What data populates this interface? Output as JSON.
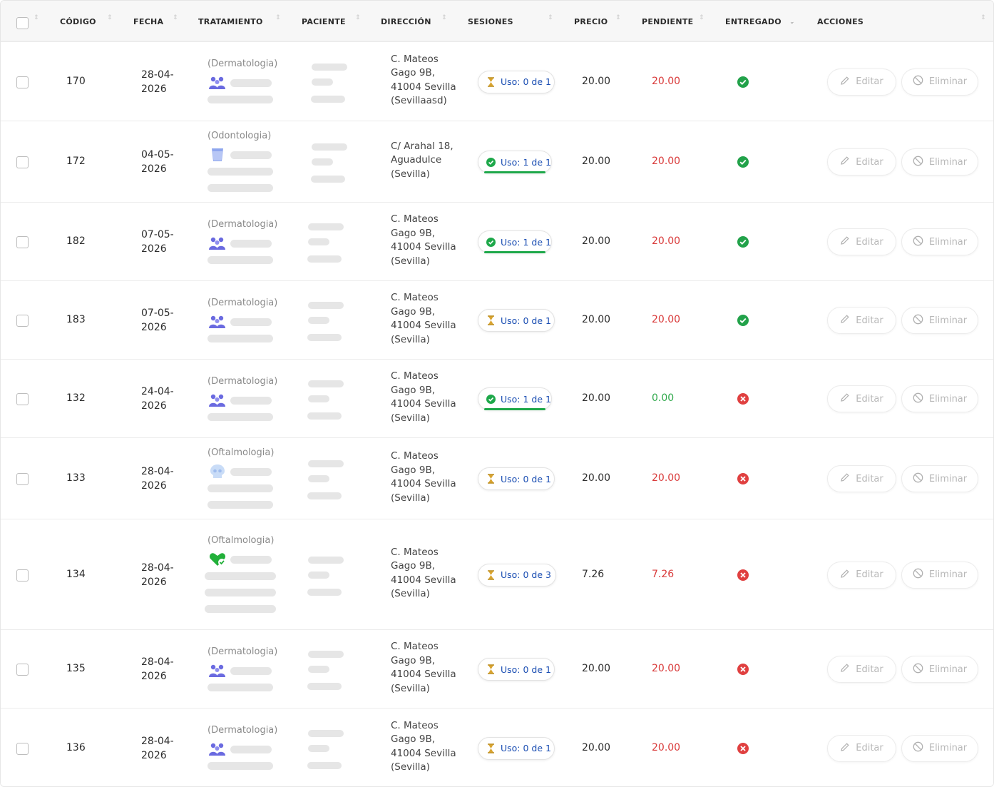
{
  "header": {
    "codigo": "CÓDIGO",
    "fecha": "FECHA",
    "tratamiento": "TRATAMIENTO",
    "paciente": "PACIENTE",
    "direccion": "DIRECCIÓN",
    "sesiones": "SESIONES",
    "precio": "PRECIO",
    "pendiente": "PENDIENTE",
    "entregado": "ENTREGADO",
    "acciones": "ACCIONES"
  },
  "actions": {
    "edit_label": "Editar",
    "delete_label": "Eliminar"
  },
  "colors": {
    "pending_red": "#d93a3a",
    "paid_green": "#2ea84a",
    "usage_blue": "#1c4fb3",
    "ok_green": "#22a24a",
    "fail_red": "#e04040"
  },
  "rows": [
    {
      "codigo": "170",
      "fecha": [
        "28-04-",
        "2026"
      ],
      "especialidad": "(Dermatologia)",
      "icon": "people-icon",
      "direccion": [
        "C. Mateos",
        "Gago 9B,",
        "41004 Sevilla",
        "(Sevillaasd)"
      ],
      "uso": "Uso: 0 de 1",
      "uso_state": "pending",
      "precio": "20.00",
      "pendiente": "20.00",
      "entregado": true
    },
    {
      "codigo": "172",
      "fecha": [
        "04-05-",
        "2026"
      ],
      "especialidad": "(Odontologia)",
      "icon": "glass-icon",
      "direccion": [
        "C/ Arahal 18,",
        "Aguadulce",
        "(Sevilla)"
      ],
      "uso": "Uso: 1 de 1",
      "uso_state": "done",
      "precio": "20.00",
      "pendiente": "20.00",
      "entregado": true
    },
    {
      "codigo": "182",
      "fecha": [
        "07-05-",
        "2026"
      ],
      "especialidad": "(Dermatologia)",
      "icon": "people-icon",
      "direccion": [
        "C. Mateos",
        "Gago 9B,",
        "41004 Sevilla",
        "(Sevilla)"
      ],
      "uso": "Uso: 1 de 1",
      "uso_state": "done",
      "precio": "20.00",
      "pendiente": "20.00",
      "entregado": true
    },
    {
      "codigo": "183",
      "fecha": [
        "07-05-",
        "2026"
      ],
      "especialidad": "(Dermatologia)",
      "icon": "people-icon",
      "direccion": [
        "C. Mateos",
        "Gago 9B,",
        "41004 Sevilla",
        "(Sevilla)"
      ],
      "uso": "Uso: 0 de 1",
      "uso_state": "pending",
      "precio": "20.00",
      "pendiente": "20.00",
      "entregado": true
    },
    {
      "codigo": "132",
      "fecha": [
        "24-04-",
        "2026"
      ],
      "especialidad": "(Dermatologia)",
      "icon": "people-icon",
      "direccion": [
        "C. Mateos",
        "Gago 9B,",
        "41004 Sevilla",
        "(Sevilla)"
      ],
      "uso": "Uso: 1 de 1",
      "uso_state": "done",
      "precio": "20.00",
      "pendiente": "0.00",
      "entregado": false
    },
    {
      "codigo": "133",
      "fecha": [
        "28-04-",
        "2026"
      ],
      "especialidad": "(Oftalmologia)",
      "icon": "skull-icon",
      "direccion": [
        "C. Mateos",
        "Gago 9B,",
        "41004 Sevilla",
        "(Sevilla)"
      ],
      "uso": "Uso: 0 de 1",
      "uso_state": "pending",
      "precio": "20.00",
      "pendiente": "20.00",
      "entregado": false
    },
    {
      "codigo": "134",
      "fecha": [
        "28-04-",
        "2026"
      ],
      "especialidad": "(Oftalmologia)",
      "icon": "heart-check-icon",
      "direccion": [
        "C. Mateos",
        "Gago 9B,",
        "41004 Sevilla",
        "(Sevilla)"
      ],
      "uso": "Uso: 0 de 3",
      "uso_state": "pending",
      "precio": "7.26",
      "pendiente": "7.26",
      "entregado": false
    },
    {
      "codigo": "135",
      "fecha": [
        "28-04-",
        "2026"
      ],
      "especialidad": "(Dermatologia)",
      "icon": "people-icon",
      "direccion": [
        "C. Mateos",
        "Gago 9B,",
        "41004 Sevilla",
        "(Sevilla)"
      ],
      "uso": "Uso: 0 de 1",
      "uso_state": "pending",
      "precio": "20.00",
      "pendiente": "20.00",
      "entregado": false
    },
    {
      "codigo": "136",
      "fecha": [
        "28-04-",
        "2026"
      ],
      "especialidad": "(Dermatologia)",
      "icon": "people-icon",
      "direccion": [
        "C. Mateos",
        "Gago 9B,",
        "41004 Sevilla",
        "(Sevilla)"
      ],
      "uso": "Uso: 0 de 1",
      "uso_state": "pending",
      "precio": "20.00",
      "pendiente": "20.00",
      "entregado": false
    }
  ]
}
